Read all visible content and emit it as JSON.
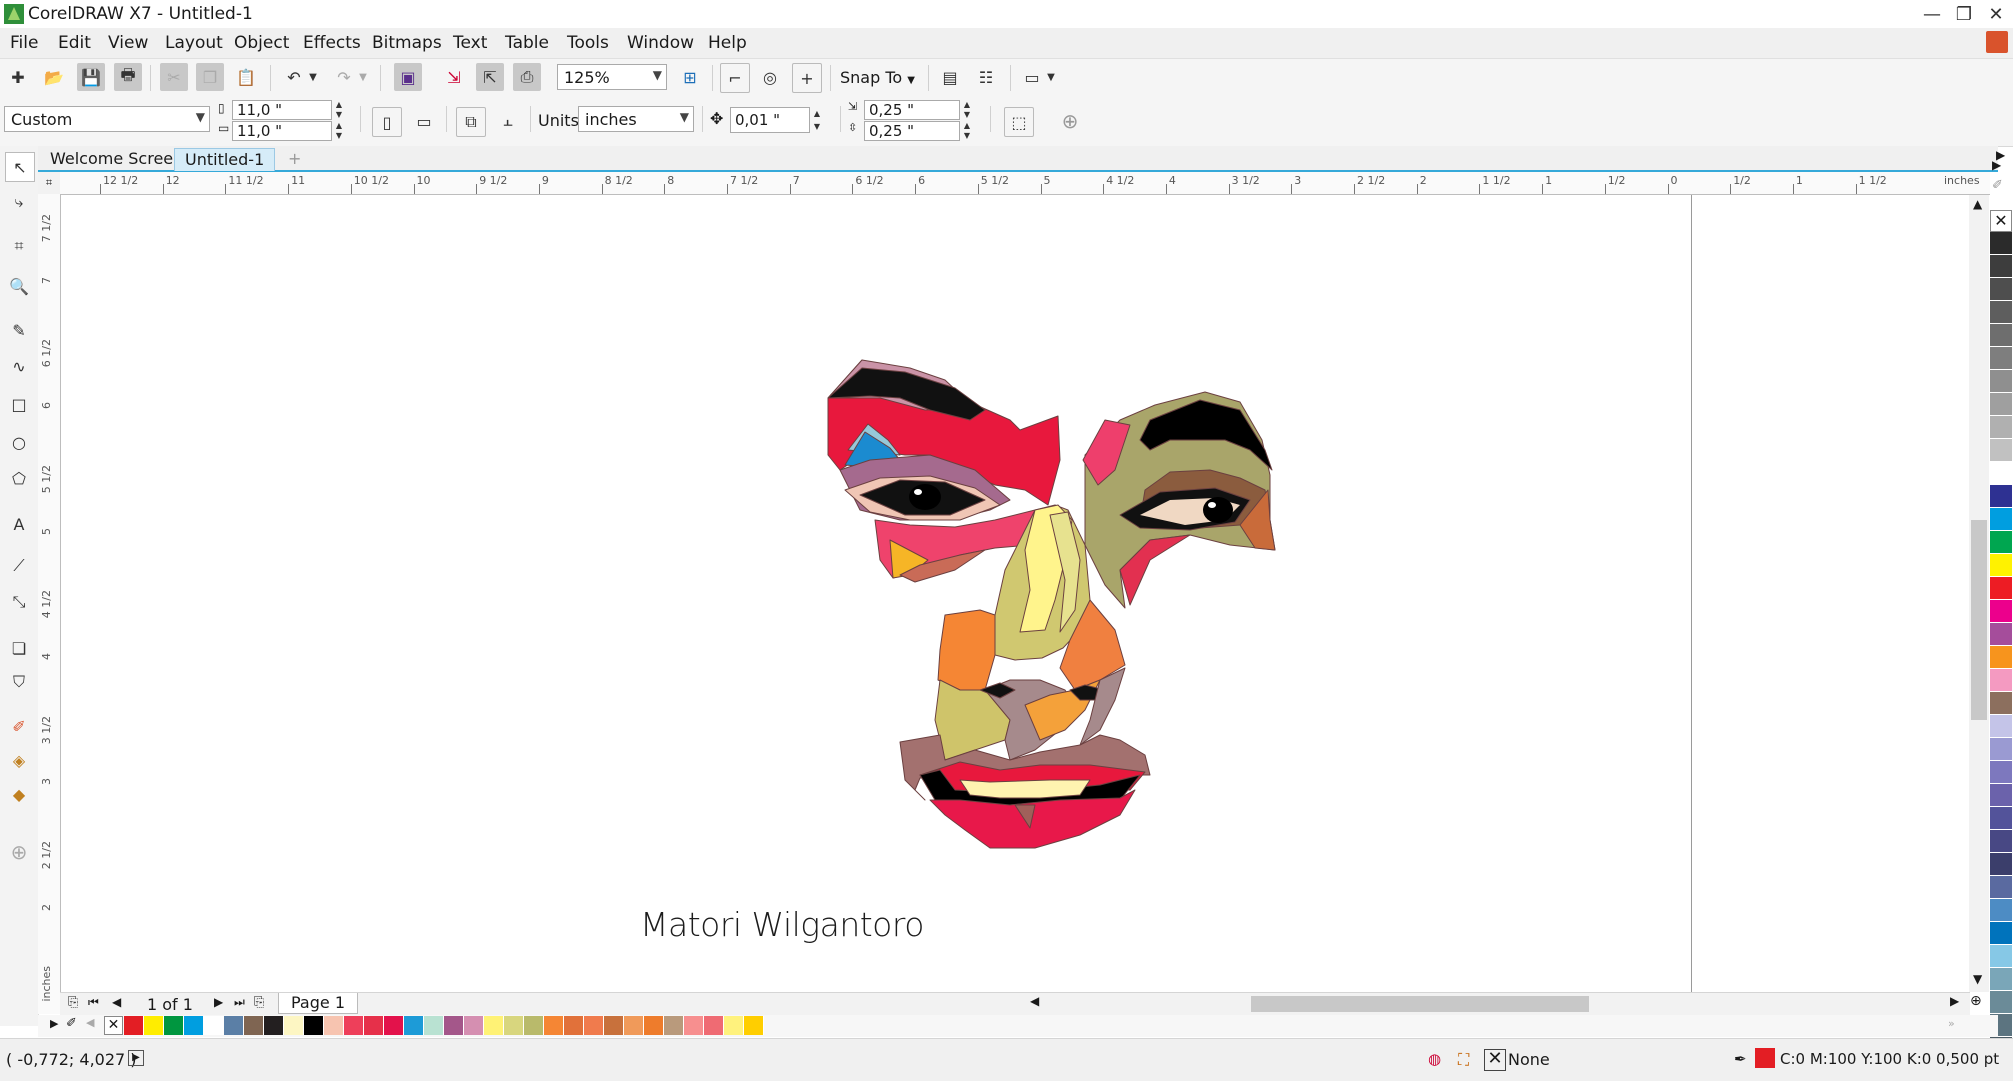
{
  "window": {
    "title": "CorelDRAW X7 - Untitled-1",
    "minimize": "—",
    "restore": "❐",
    "close": "✕"
  },
  "menu": [
    "File",
    "Edit",
    "View",
    "Layout",
    "Object",
    "Effects",
    "Bitmaps",
    "Text",
    "Table",
    "Tools",
    "Window",
    "Help"
  ],
  "standard_toolbar": {
    "zoom_value": "125%",
    "snap_to_label": "Snap To"
  },
  "property_bar": {
    "page_preset": "Custom",
    "page_width": "11,0 \"",
    "page_height": "11,0 \"",
    "units_label": "Units:",
    "units_value": "inches",
    "nudge_value": "0,01 \"",
    "duplicate_x": "0,25 \"",
    "duplicate_y": "0,25 \""
  },
  "doc_tabs": [
    {
      "label": "Welcome Screen",
      "active": false
    },
    {
      "label": "Untitled-1",
      "active": true
    }
  ],
  "horizontal_ruler": {
    "labels": [
      "12 1/2",
      "12",
      "11 1/2",
      "11",
      "10 1/2",
      "10",
      "9 1/2",
      "9",
      "8 1/2",
      "8",
      "7 1/2",
      "7",
      "6 1/2",
      "6",
      "5 1/2",
      "5",
      "4 1/2",
      "4",
      "3 1/2",
      "3",
      "2 1/2",
      "2",
      "1 1/2",
      "1",
      "1/2",
      "0",
      "1/2",
      "1",
      "1 1/2"
    ],
    "unit": "inches"
  },
  "vertical_ruler": {
    "labels": [
      "7 1/2",
      "7",
      "6 1/2",
      "6",
      "5 1/2",
      "5",
      "4 1/2",
      "4",
      "3 1/2",
      "3",
      "2 1/2",
      "2",
      "inches"
    ]
  },
  "artwork": {
    "signature_text": "Matori Wilgantoro"
  },
  "page_nav": {
    "page_counter": "1 of 1",
    "page_tab": "Page 1"
  },
  "palette_bottom": [
    "none",
    "#e31e24",
    "#ffed00",
    "#00963f",
    "#009ee0",
    "#ffffff",
    "#5b7fa6",
    "#7f6552",
    "#231f20",
    "#fdf6c3",
    "#000000",
    "#f7c4b0",
    "#ee3f5a",
    "#e6304a",
    "#e3124b",
    "#1d9bd7",
    "#b9e2d2",
    "#a4578a",
    "#d58fb1",
    "#fff275",
    "#d8d67e",
    "#b9ba6b",
    "#f58634",
    "#e1713a",
    "#f07b4d",
    "#c8713c",
    "#f09a5a",
    "#ee7c2c",
    "#b99a7c",
    "#f78f8f",
    "#ef6b73",
    "#fff27d",
    "#ffce00"
  ],
  "palette_right": [
    "none",
    "#2b2b2b",
    "#3d3d3d",
    "#4e4e4e",
    "#5e5e5e",
    "#6e6e6e",
    "#7e7e7e",
    "#8f8f8f",
    "#9f9f9f",
    "#b0b0b0",
    "#c1c1c1",
    "#ffffff",
    "#2e3192",
    "#009ee0",
    "#00a650",
    "#fff200",
    "#ed1c24",
    "#ec008c",
    "#a54d9b",
    "#f7941d",
    "#f49ac1",
    "#8c6f5e",
    "#c4c4e8",
    "#9a9ad2",
    "#7d78be",
    "#6b62ab",
    "#53539a",
    "#484884",
    "#3b3e6b",
    "#5a6aa0",
    "#4d8cc4",
    "#0073bc",
    "#86c8e6",
    "#7aa6b8",
    "#6b8b98",
    "#5c7480",
    "#4a5a64"
  ],
  "status": {
    "coordinates": "( -0,772; 4,027 )",
    "fill_label": "None",
    "outline_label": "C:0 M:100 Y:100 K:0  0,500 pt",
    "outline_color": "#e31e24"
  }
}
